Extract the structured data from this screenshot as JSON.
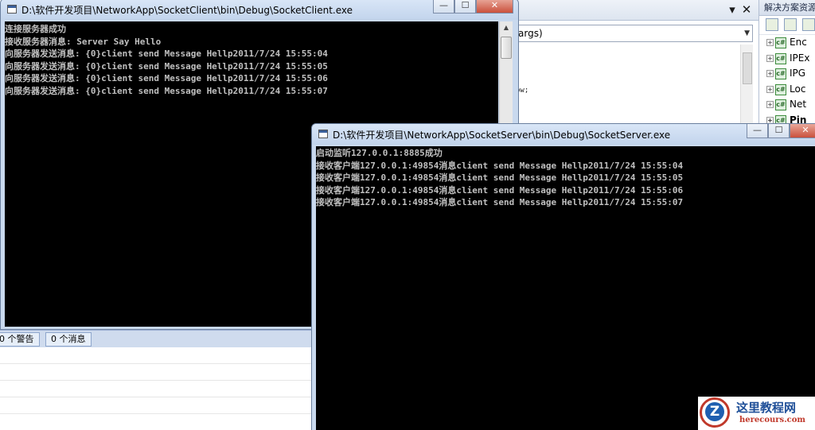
{
  "ide": {
    "method_combo": "args)",
    "code_fragment": "ow;",
    "solution_explorer": {
      "title": "解决方案资源",
      "items": [
        {
          "label": "Enc"
        },
        {
          "label": "IPEx"
        },
        {
          "label": "IPG"
        },
        {
          "label": "Loc"
        },
        {
          "label": "Net"
        },
        {
          "label": "Pin"
        }
      ]
    },
    "output_tabs": [
      "0 个警告",
      "0 个消息"
    ]
  },
  "client_window": {
    "title": "D:\\软件开发项目\\NetworkApp\\SocketClient\\bin\\Debug\\SocketClient.exe",
    "controls": {
      "minimize": "—",
      "maximize": "☐",
      "close": "✕"
    },
    "lines": [
      "连接服务器成功",
      "接收服务器消息: Server Say Hello",
      "向服务器发送消息: {0}client send Message Hellp2011/7/24 15:55:04",
      "向服务器发送消息: {0}client send Message Hellp2011/7/24 15:55:05",
      "向服务器发送消息: {0}client send Message Hellp2011/7/24 15:55:06",
      "向服务器发送消息: {0}client send Message Hellp2011/7/24 15:55:07"
    ]
  },
  "server_window": {
    "title": "D:\\软件开发项目\\NetworkApp\\SocketServer\\bin\\Debug\\SocketServer.exe",
    "controls": {
      "minimize": "—",
      "maximize": "☐",
      "close": "✕"
    },
    "lines": [
      "启动监听127.0.0.1:8885成功",
      "接收客户端127.0.0.1:49854消息client send Message Hellp2011/7/24 15:55:04",
      "接收客户端127.0.0.1:49854消息client send Message Hellp2011/7/24 15:55:05",
      "接收客户端127.0.0.1:49854消息client send Message Hellp2011/7/24 15:55:06",
      "接收客户端127.0.0.1:49854消息client send Message Hellp2011/7/24 15:55:07"
    ]
  },
  "watermark": {
    "logo_letter": "Z",
    "name": "这里教程网",
    "url": "herecours.com"
  },
  "colors": {
    "console_bg": "#000000",
    "console_text": "#c0c0c0",
    "title_bar": "#c9d9ee",
    "close_button": "#c9503c",
    "watermark_blue": "#1f4f98",
    "watermark_red": "#c0392b"
  }
}
